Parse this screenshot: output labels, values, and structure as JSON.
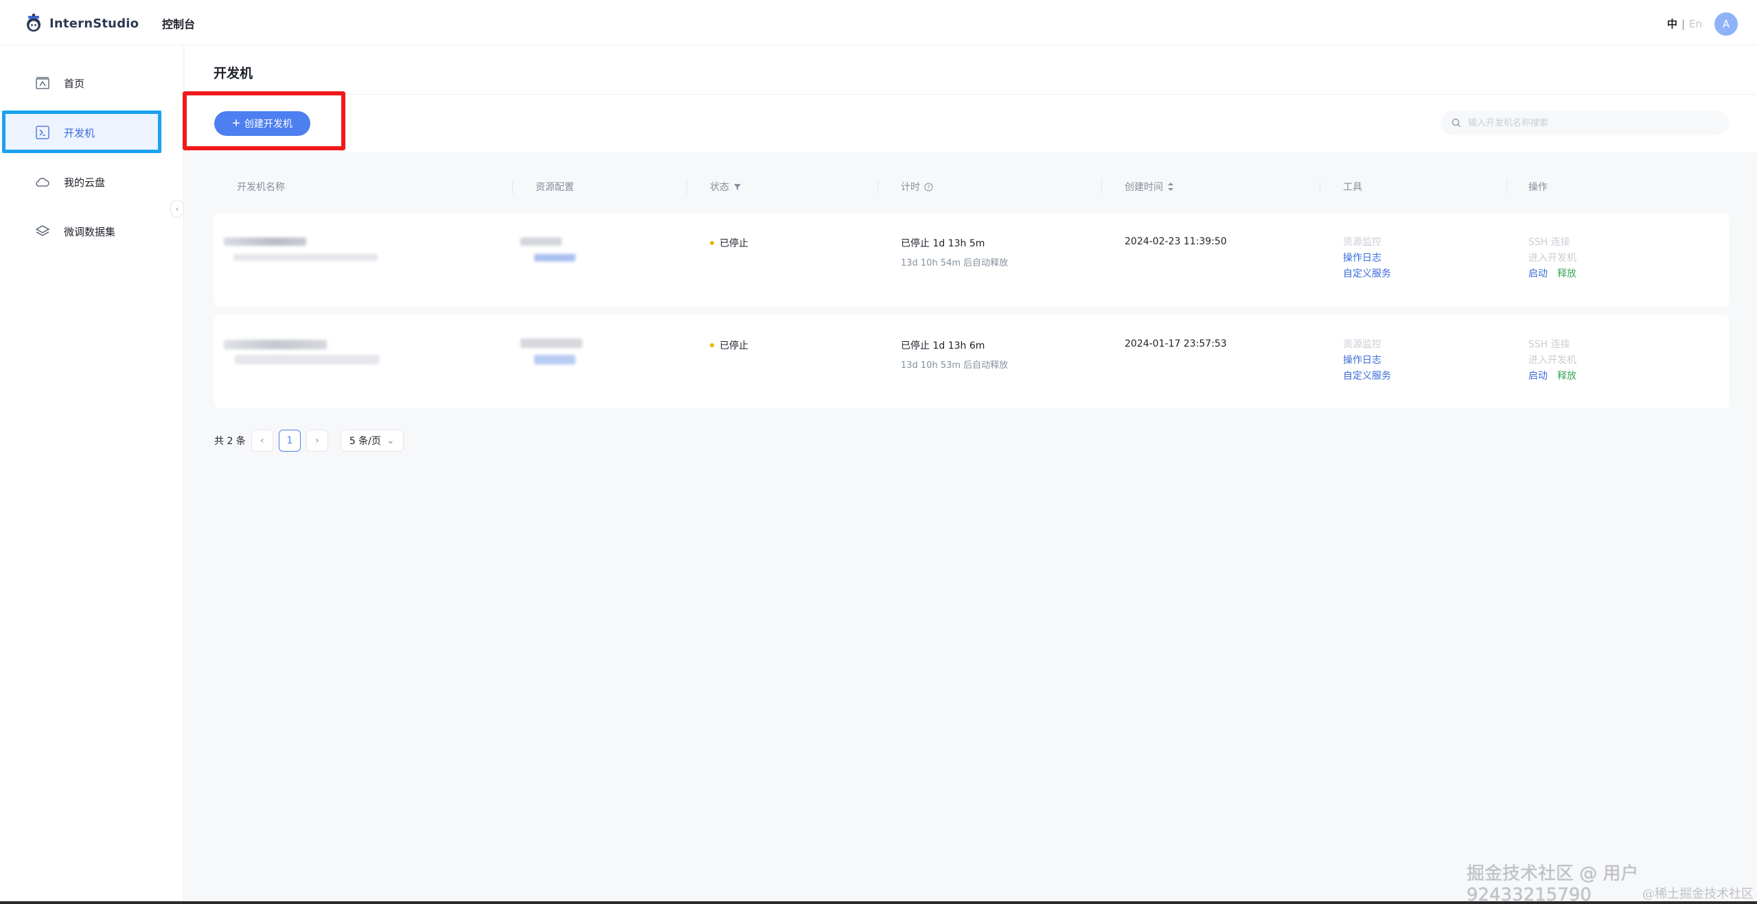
{
  "header": {
    "brand": "InternStudio",
    "console": "控制台",
    "lang_active": "中",
    "lang_sep": "|",
    "lang_other": "En",
    "avatar_initial": "A"
  },
  "sidebar": {
    "items": [
      {
        "label": "首页",
        "icon": "home-icon"
      },
      {
        "label": "开发机",
        "icon": "terminal-icon",
        "active": true
      },
      {
        "label": "我的云盘",
        "icon": "cloud-icon"
      },
      {
        "label": "微调数据集",
        "icon": "layers-icon"
      }
    ],
    "collapse_glyph": "‹"
  },
  "page": {
    "title": "开发机",
    "create_label": "创建开发机",
    "create_plus": "+",
    "search_placeholder": "输入开发机名称搜索"
  },
  "table": {
    "columns": [
      "开发机名称",
      "资源配置",
      "状态",
      "计时",
      "创建时间",
      "工具",
      "操作"
    ],
    "rows": [
      {
        "status": "已停止",
        "timer": "已停止  1d 13h 5m",
        "timer_sub": "13d 10h 54m 后自动释放",
        "created": "2024-02-23 11:39:50",
        "tools": [
          "资源监控",
          "操作日志",
          "自定义服务"
        ],
        "ops": [
          "SSH 连接",
          "进入开发机",
          "启动",
          "释放"
        ]
      },
      {
        "status": "已停止",
        "timer": "已停止  1d 13h 6m",
        "timer_sub": "13d 10h 53m 后自动释放",
        "created": "2024-01-17 23:57:53",
        "tools": [
          "资源监控",
          "操作日志",
          "自定义服务"
        ],
        "ops": [
          "SSH 连接",
          "进入开发机",
          "启动",
          "释放"
        ]
      }
    ]
  },
  "pagination": {
    "total": "共 2 条",
    "prev": "‹",
    "current": "1",
    "next": "›",
    "page_size": "5 条/页",
    "page_size_caret": "⌄"
  },
  "watermark": {
    "line1": "掘金技术社区 @ 用户92433215790",
    "line2": "@稀土掘金技术社区"
  },
  "colors": {
    "primary": "#4e7ff0",
    "link": "#3a6bd8",
    "status_stopped": "#f0b400",
    "release_green": "#3aa85a",
    "highlight_red": "#f11a1a",
    "highlight_blue": "#1aa1f0"
  }
}
